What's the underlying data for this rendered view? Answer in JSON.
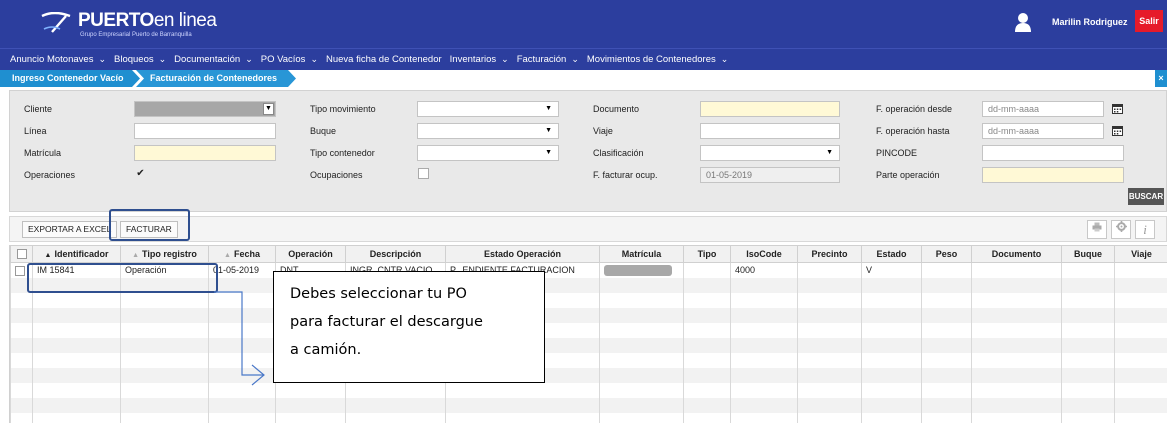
{
  "header": {
    "brand_bold": "PUERTO",
    "brand_light": "en linea",
    "brand_sub": "Grupo Empresarial Puerto de Barranquilla",
    "user_name": "Marilin Rodriguez",
    "logout_label": "Salir"
  },
  "menu": {
    "items": [
      {
        "label": "Anuncio Motonaves",
        "has_dropdown": true
      },
      {
        "label": "Bloqueos",
        "has_dropdown": true
      },
      {
        "label": "Documentación",
        "has_dropdown": true
      },
      {
        "label": "PO Vacíos",
        "has_dropdown": true
      },
      {
        "label": "Nueva ficha de Contenedor",
        "has_dropdown": false
      },
      {
        "label": "Inventarios",
        "has_dropdown": true
      },
      {
        "label": "Facturación",
        "has_dropdown": true
      },
      {
        "label": "Movimientos de Contenedores",
        "has_dropdown": true
      }
    ],
    "chevron": "⌄"
  },
  "breadcrumb": {
    "items": [
      "Ingreso Contenedor Vacío",
      "Facturación de Contenedores"
    ],
    "close": "×"
  },
  "filters": {
    "cliente": {
      "label": "Cliente",
      "value": ""
    },
    "linea": {
      "label": "Línea",
      "value": ""
    },
    "matricula": {
      "label": "Matrícula",
      "value": ""
    },
    "operaciones": {
      "label": "Operaciones",
      "checked": true,
      "mark": "✔"
    },
    "tipo_movimiento": {
      "label": "Tipo movimiento",
      "value": ""
    },
    "buque": {
      "label": "Buque",
      "value": ""
    },
    "tipo_contenedor": {
      "label": "Tipo contenedor",
      "value": ""
    },
    "ocupaciones": {
      "label": "Ocupaciones",
      "checked": false
    },
    "documento": {
      "label": "Documento",
      "value": ""
    },
    "viaje": {
      "label": "Viaje",
      "value": ""
    },
    "clasificacion": {
      "label": "Clasificación",
      "value": ""
    },
    "f_facturar_ocup": {
      "label": "F. facturar ocup.",
      "value": "01-05-2019"
    },
    "f_operacion_desde": {
      "label": "F. operación desde",
      "placeholder": "dd-mm-aaaa"
    },
    "f_operacion_hasta": {
      "label": "F. operación hasta",
      "placeholder": "dd-mm-aaaa"
    },
    "pincode": {
      "label": "PINCODE",
      "value": ""
    },
    "parte_operacion": {
      "label": "Parte operación",
      "value": ""
    },
    "search_label": "BUSCAR"
  },
  "toolbar": {
    "export_label": "EXPORTAR A EXCEL",
    "invoice_label": "FACTURAR",
    "icons": [
      "print-icon",
      "gear-icon",
      "info-icon"
    ],
    "info_glyph": "i"
  },
  "table": {
    "columns": [
      {
        "label": "Identificador",
        "sort": "asc"
      },
      {
        "label": "Tipo registro",
        "sort": "muted"
      },
      {
        "label": "Fecha",
        "sort": "muted"
      },
      {
        "label": "Operación",
        "sort": ""
      },
      {
        "label": "Descripción",
        "sort": ""
      },
      {
        "label": "Estado Operación",
        "sort": ""
      },
      {
        "label": "Matrícula",
        "sort": ""
      },
      {
        "label": "Tipo",
        "sort": ""
      },
      {
        "label": "IsoCode",
        "sort": ""
      },
      {
        "label": "Precinto",
        "sort": ""
      },
      {
        "label": "Estado",
        "sort": ""
      },
      {
        "label": "Peso",
        "sort": ""
      },
      {
        "label": "Documento",
        "sort": ""
      },
      {
        "label": "Buque",
        "sort": ""
      },
      {
        "label": "Viaje",
        "sort": ""
      }
    ],
    "rows": [
      {
        "identificador": "IM 15841",
        "tipo_registro": "Operación",
        "fecha": "01-05-2019",
        "operacion": "DNT...",
        "descripcion": "INGR. CNTR VACIO",
        "estado_operacion": "P...ENDIENTE FACTURACION",
        "matricula_redacted": true,
        "tipo": "",
        "isocode": "4000",
        "precinto": "",
        "estado": "V",
        "peso": "",
        "documento": "",
        "buque": "",
        "viaje": ""
      }
    ],
    "empty_rows": 10
  },
  "annotation": {
    "callout_lines": [
      "Debes seleccionar tu PO",
      "para facturar el descargue",
      "a camión."
    ]
  },
  "colors": {
    "header_bg": "#2c3e9e",
    "breadcrumb_bg": "#1f8fd0",
    "logout_bg": "#e61a2a",
    "highlight_border": "#2f4f8f",
    "required_field": "#fff9d6"
  }
}
